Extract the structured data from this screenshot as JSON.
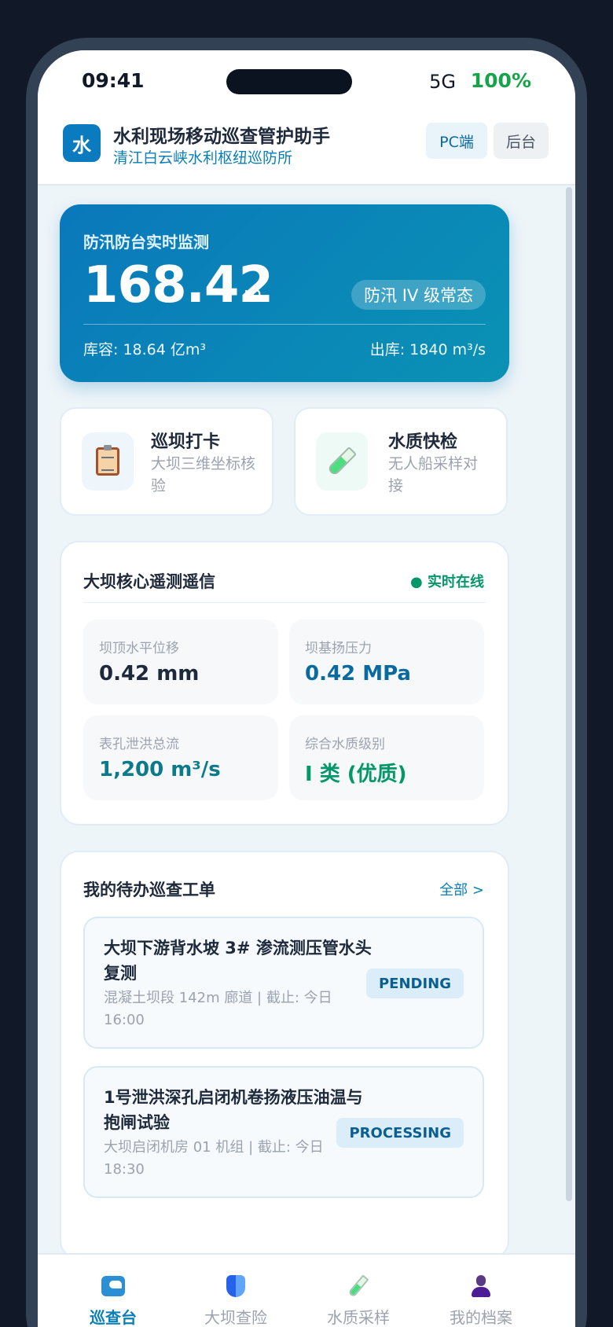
{
  "status_bar": {
    "time": "09:41",
    "signal": "5G",
    "battery": "100%"
  },
  "header": {
    "logo_char": "水",
    "title": "水利现场移动巡查管护助手",
    "subtitle": "清江白云峡水利枢纽巡防所",
    "pc_button": "PC端",
    "admin_button": "后台"
  },
  "monitor": {
    "title": "防汛防台实时监测",
    "water_level": "168.42",
    "unit": "m",
    "level_badge": "防汛 IV 级常态",
    "capacity": "库容: 18.64 亿m³",
    "outflow": "出库: 1840 m³/s"
  },
  "actions": [
    {
      "title": "巡坝打卡",
      "subtitle": "大坝三维坐标核验",
      "icon": "clipboard-icon"
    },
    {
      "title": "水质快检",
      "subtitle": "无人船采样对接",
      "icon": "test-tube-icon"
    }
  ],
  "telemetry": {
    "title": "大坝核心遥测遥信",
    "status": "● 实时在线",
    "metrics": [
      {
        "label": "坝顶水平位移",
        "value": "0.42 mm"
      },
      {
        "label": "坝基扬压力",
        "value": "0.42 MPa"
      },
      {
        "label": "表孔泄洪总流",
        "value": "1,200 m³/s"
      },
      {
        "label": "综合水质级别",
        "value": "Ⅰ 类 (优质)"
      }
    ]
  },
  "orders": {
    "title": "我的待办巡查工单",
    "view_all": "全部 >",
    "items": [
      {
        "title": "大坝下游背水坡 3# 渗流测压管水头复测",
        "detail": "混凝土坝段 142m 廊道 | 截止: 今日 16:00",
        "status": "PENDING"
      },
      {
        "title": "1号泄洪深孔启闭机卷扬液压油温与抱闸试验",
        "detail": "大坝启闭机房 01 机组 | 截止: 今日 18:30",
        "status": "PROCESSING"
      }
    ]
  },
  "tabs": [
    {
      "label": "巡查台",
      "icon": "patrol-icon",
      "active": true
    },
    {
      "label": "大坝查险",
      "icon": "shield-icon",
      "active": false
    },
    {
      "label": "水质采样",
      "icon": "test-tube-icon",
      "active": false
    },
    {
      "label": "我的档案",
      "icon": "user-icon",
      "active": false
    }
  ],
  "colors": {
    "accent": "#0a7fb5",
    "monitor_gradient_start": "#0a78bb",
    "monitor_gradient_end": "#0a92b4",
    "online_green": "#059669",
    "battery_green": "#16a34a"
  }
}
